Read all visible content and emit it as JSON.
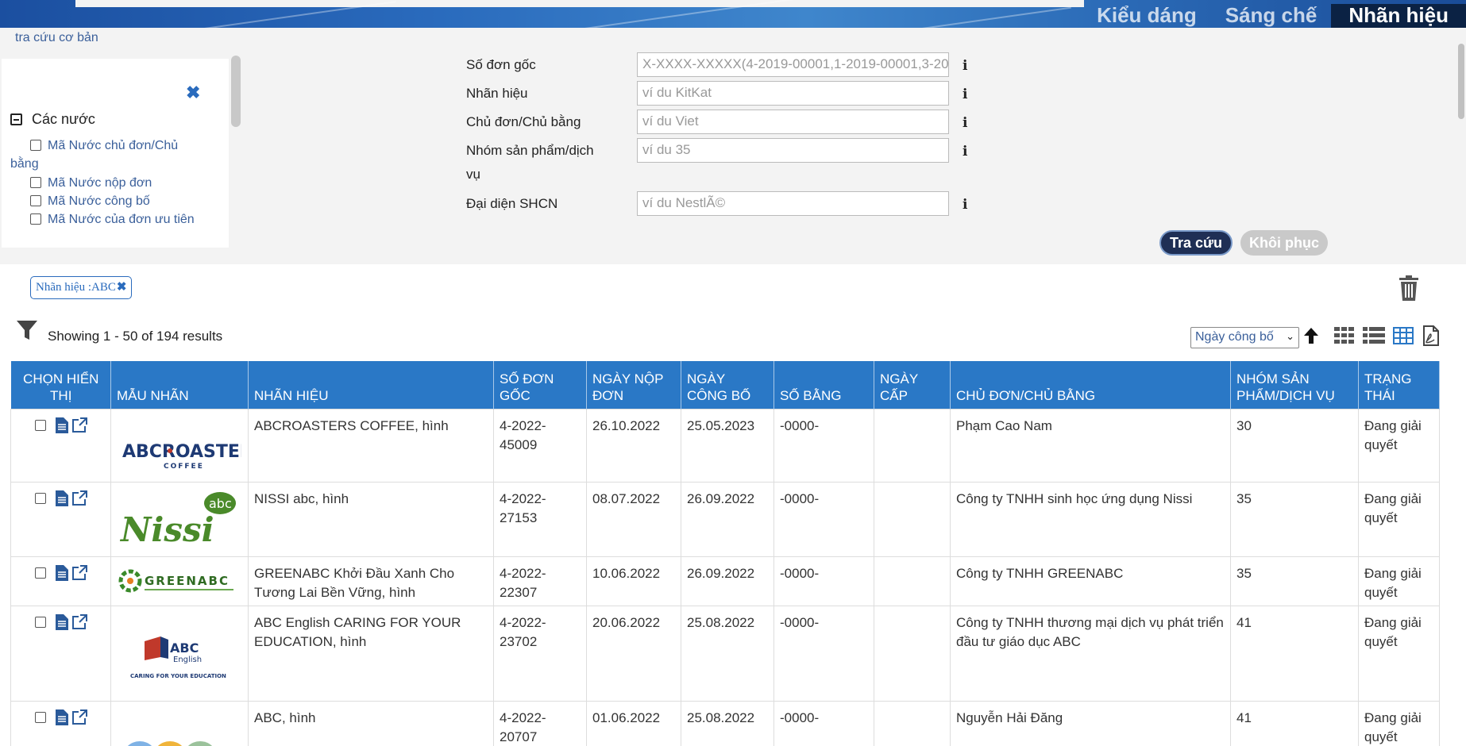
{
  "banner": {
    "tabs": [
      {
        "label": "Kiểu dáng"
      },
      {
        "label": "Sáng chế"
      },
      {
        "label": "Nhãn hiệu"
      }
    ]
  },
  "filters": {
    "basic_search_link": "tra cứu cơ bản",
    "group_title": "Các nước",
    "options": [
      "Mã Nước chủ đơn/Chủ",
      "bằng",
      "Mã Nước nộp đơn",
      "Mã Nước công bố",
      "Mã Nước của đơn ưu tiên"
    ]
  },
  "form": {
    "fields": [
      {
        "label": "Số đơn gốc",
        "placeholder": "X-XXXX-XXXXX(4-2019-00001,1-2019-00001,3-20"
      },
      {
        "label": "Nhãn hiệu",
        "placeholder": "ví du KitKat"
      },
      {
        "label": "Chủ đơn/Chủ bằng",
        "placeholder": "ví du Viet"
      },
      {
        "label": "Nhóm sản phẩm/dịch",
        "label2": "vụ",
        "placeholder": "ví du 35"
      },
      {
        "label": "Đại diện SHCN",
        "placeholder": "ví du NestlÃ©"
      }
    ],
    "info_glyph": "i",
    "search_button": "Tra cứu",
    "reset_button": "Khôi phục"
  },
  "results": {
    "filter_chip": "Nhãn hiệu :ABC",
    "chip_close": "✖",
    "showing": "Showing 1 - 50 of 194 results",
    "sort_value": "Ngày công bố",
    "sort_chevron": "⌄"
  },
  "table": {
    "headers": [
      "CHỌN HIỂN THỊ",
      "MẪU NHÃN",
      "NHÃN HIỆU",
      "SỐ ĐƠN GỐC",
      "NGÀY NỘP ĐƠN",
      "NGÀY CÔNG BỐ",
      "SỐ BẰNG",
      "NGÀY CẤP",
      "CHỦ ĐƠN/CHỦ BẰNG",
      "NHÓM SẢN PHẨM/DỊCH VỤ",
      "TRẠNG THÁI"
    ],
    "rows": [
      {
        "mark": "ABCROASTERS COFFEE, hình",
        "app_no": "4-2022-45009",
        "filed": "26.10.2022",
        "published": "25.05.2023",
        "cert": "-0000-",
        "granted": "",
        "owner": "Phạm Cao Nam",
        "class": "30",
        "status": "Đang giải quyết",
        "logo": {
          "kind": "abcroasters",
          "text1": "ABCROASTERS",
          "text2": "COFFEE"
        }
      },
      {
        "mark": "NISSI abc, hình",
        "app_no": "4-2022-27153",
        "filed": "08.07.2022",
        "published": "26.09.2022",
        "cert": "-0000-",
        "granted": "",
        "owner": "Công ty TNHH sinh học ứng dụng Nissi",
        "class": "35",
        "status": "Đang giải quyết",
        "logo": {
          "kind": "nissi",
          "text1": "Nissi",
          "text2": "abc"
        }
      },
      {
        "mark": "GREENABC Khởi Đầu Xanh Cho Tương Lai Bền Vững, hình",
        "app_no": "4-2022-22307",
        "filed": "10.06.2022",
        "published": "26.09.2022",
        "cert": "-0000-",
        "granted": "",
        "owner": "Công ty TNHH GREENABC",
        "class": "35",
        "status": "Đang giải quyết",
        "logo": {
          "kind": "greenabc",
          "text1": "GREENABC"
        }
      },
      {
        "mark": "ABC English CARING FOR YOUR EDUCATION, hình",
        "app_no": "4-2022-23702",
        "filed": "20.06.2022",
        "published": "25.08.2022",
        "cert": "-0000-",
        "granted": "",
        "owner": "Công ty TNHH thương mại dịch vụ phát triển đầu tư giáo dục ABC",
        "class": "41",
        "status": "Đang giải quyết",
        "logo": {
          "kind": "abcenglish",
          "text1": "ABC",
          "text2": "English",
          "text3": "CARING FOR YOUR EDUCATION"
        }
      },
      {
        "mark": "ABC, hình",
        "app_no": "4-2022-20707",
        "filed": "01.06.2022",
        "published": "25.08.2022",
        "cert": "-0000-",
        "granted": "",
        "owner": "Nguyễn Hải Đăng",
        "class": "41",
        "status": "Đang giải quyết",
        "logo": {
          "kind": "abc"
        }
      }
    ]
  },
  "colors": {
    "header_blue": "#2a78c6",
    "link_blue": "#3a5f9a",
    "search_btn": "#1f2f55",
    "reset_btn": "#c9c9c9"
  }
}
